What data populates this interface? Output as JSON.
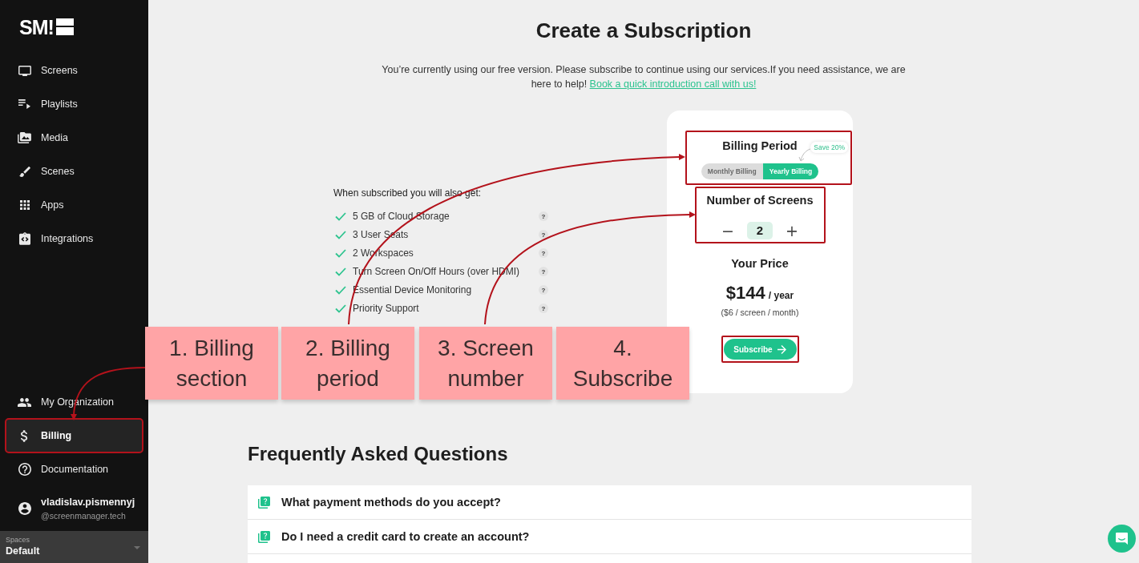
{
  "sidebar": {
    "logo": "SM!",
    "nav": [
      {
        "label": "Screens",
        "selected": false,
        "highlighted": false
      },
      {
        "label": "Playlists",
        "selected": false,
        "highlighted": false
      },
      {
        "label": "Media",
        "selected": false,
        "highlighted": false
      },
      {
        "label": "Scenes",
        "selected": false,
        "highlighted": false
      },
      {
        "label": "Apps",
        "selected": false,
        "highlighted": false
      },
      {
        "label": "Integrations",
        "selected": false,
        "highlighted": false
      }
    ],
    "bottom_nav": [
      {
        "label": "My Organization",
        "selected": false,
        "highlighted": false
      },
      {
        "label": "Billing",
        "selected": true,
        "highlighted": true
      },
      {
        "label": "Documentation",
        "selected": false,
        "highlighted": false
      }
    ],
    "user": {
      "name": "vladislav.pismennyj",
      "handle": "@screenmanager.tech"
    },
    "spaces": {
      "label": "Spaces",
      "value": "Default"
    }
  },
  "header": {
    "title": "Create a Subscription",
    "intro": "You’re currently using our free version. Please subscribe to continue using our services.If you need assistance, we are here to help!",
    "link": "Book a quick introduction call with us!"
  },
  "benefits": {
    "heading": "When subscribed you will also get:",
    "items": [
      {
        "text": "5 GB of Cloud Storage",
        "hint": "?"
      },
      {
        "text": "3 User Seats",
        "hint": "?"
      },
      {
        "text": "2 Workspaces",
        "hint": "?"
      },
      {
        "text": "Turn Screen On/Off Hours (over HDMI)",
        "hint": "?"
      },
      {
        "text": "Essential Device Monitoring",
        "hint": "?"
      },
      {
        "text": "Priority Support",
        "hint": "?"
      }
    ]
  },
  "plan_card": {
    "billing_period": {
      "title": "Billing Period",
      "highlighted": true,
      "badge": "Save 20%",
      "options": [
        {
          "label": "Monthly Billing",
          "selected": false
        },
        {
          "label": "Yearly Billing",
          "selected": true
        }
      ]
    },
    "screens": {
      "title": "Number of Screens",
      "highlighted": true,
      "decrement": "−",
      "value": "2",
      "increment": "+"
    },
    "price": {
      "title": "Your Price",
      "amount": "$144",
      "unit": "/ year",
      "detail": "($6 / screen / month)"
    },
    "subscribe": {
      "label": "Subscribe",
      "highlighted": true
    }
  },
  "faq": {
    "title": "Frequently Asked Questions",
    "items": [
      {
        "question": "What payment methods do you accept?"
      },
      {
        "question": "Do I need a credit card to create an account?"
      }
    ]
  },
  "annotations": {
    "notes": [
      {
        "text": "1. Billing section"
      },
      {
        "text": "2. Billing period"
      },
      {
        "text": "3. Screen number"
      },
      {
        "text": "4. Subscribe"
      }
    ]
  }
}
